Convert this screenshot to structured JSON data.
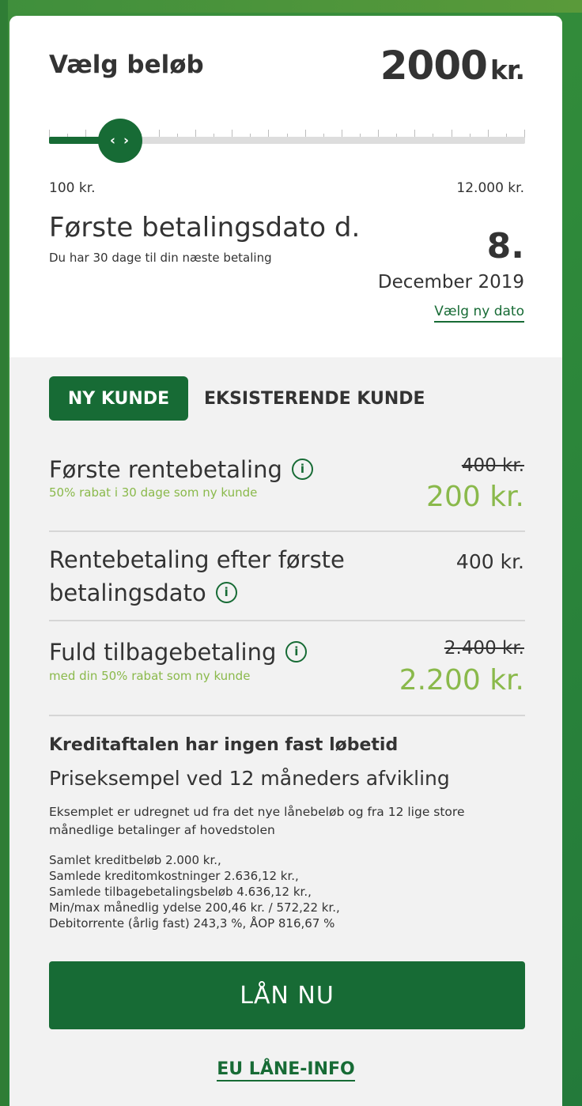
{
  "amount": {
    "title": "Vælg beløb",
    "value": "2000",
    "unit": "kr.",
    "slider_fraction": 0.15,
    "thumb_glyph": "‹ ›",
    "min_label": "100 kr.",
    "max_label": "12.000 kr."
  },
  "payment_date": {
    "title": "Første betalingsdato d.",
    "subtitle": "Du har 30 dage til din næste betaling",
    "day": "8.",
    "month_year": "December 2019",
    "change_link": "Vælg ny dato"
  },
  "tabs": {
    "new_customer": "NY KUNDE",
    "existing_customer": "EKSISTERENDE KUNDE"
  },
  "rows": [
    {
      "label": "Første rentebetaling",
      "subtitle": "50% rabat i 30 dage som ny kunde",
      "old_price": "400 kr.",
      "new_price": "200 kr."
    },
    {
      "label_line1": "Rentebetaling efter første",
      "label_line2": "betalingsdato",
      "price": "400 kr."
    },
    {
      "label": "Fuld tilbagebetaling",
      "subtitle": "med din 50% rabat som ny kunde",
      "old_price": "2.400 kr.",
      "new_price": "2.200 kr."
    }
  ],
  "credit": {
    "title": "Kreditaftalen har ingen fast løbetid",
    "example": "Priseksempel ved 12 måneders afvikling",
    "description": "Eksemplet er udregnet ud fra det nye lånebeløb og fra 12 lige store månedlige betalinger af hovedstolen",
    "details": [
      "Samlet kreditbeløb  2.000 kr.,",
      "Samlede kreditomkostninger  2.636,12 kr.,",
      "Samlede tilbagebetalingsbeløb  4.636,12 kr.,",
      "Min/max månedlig ydelse  200,46 kr. / 572,22 kr.,",
      "Debitorrente (årlig fast)  243,3 %,  ÅOP  816,67 %"
    ]
  },
  "cta_label": "LÅN NU",
  "eu_link": "EU LÅNE-INFO",
  "info_glyph": "i",
  "colors": {
    "brand_green": "#176b35",
    "discount_green": "#8ab94b",
    "panel_gray": "#f2f2f2"
  }
}
